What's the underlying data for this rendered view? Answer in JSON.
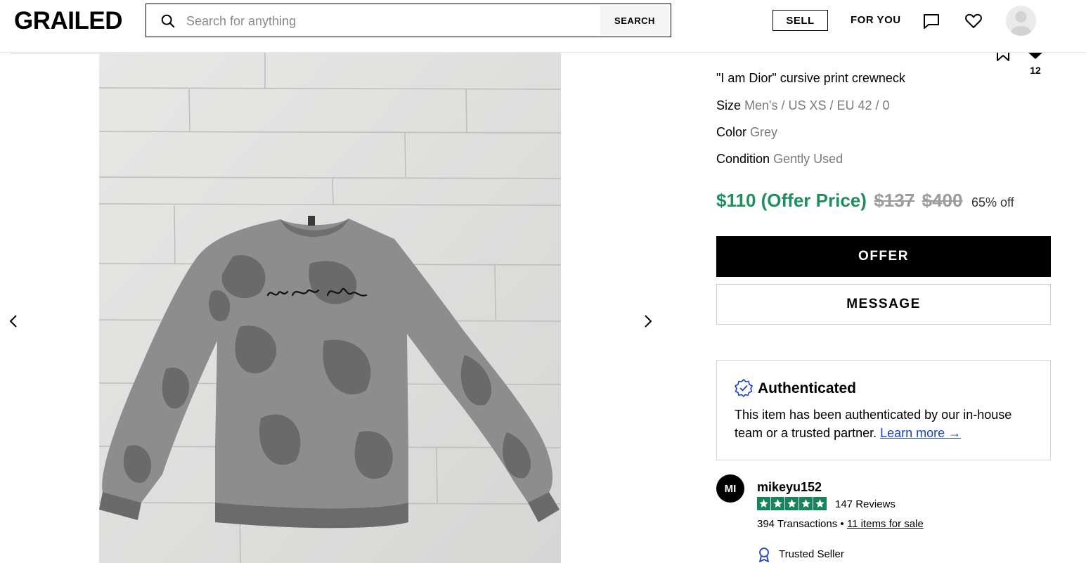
{
  "header": {
    "logo": "GRAILED",
    "search_placeholder": "Search for anything",
    "search_button": "SEARCH",
    "sell": "SELL",
    "for_you": "FOR YOU",
    "icons": [
      "search-icon",
      "message-icon",
      "heart-icon",
      "avatar"
    ]
  },
  "gallery": {
    "prev_icon": "chevron-left-icon",
    "next_icon": "chevron-right-icon",
    "photo_print": "i am dior"
  },
  "listing": {
    "like_count": "12",
    "title": "\"I am Dior\" cursive print crewneck",
    "size_label": "Size",
    "size_value": "Men's / US XS / EU 42 / 0",
    "color_label": "Color",
    "color_value": "Grey",
    "condition_label": "Condition",
    "condition_value": "Gently Used",
    "offer_price": "$110 (Offer Price)",
    "strike_price_1": "$137",
    "strike_price_2": "$400",
    "discount": "65% off",
    "offer_button": "OFFER",
    "message_button": "MESSAGE"
  },
  "auth": {
    "heading": "Authenticated",
    "text": "This item has been authenticated by our in-house team or a trusted partner.",
    "link": "Learn more →"
  },
  "seller": {
    "initials": "MI",
    "name": "mikeyu152",
    "rating": 5,
    "reviews": "147 Reviews",
    "transactions": "394 Transactions",
    "bullet": "•",
    "items_link": "11 items for sale",
    "trusted": "Trusted Seller"
  },
  "colors": {
    "accent_green": "#1f8f5f",
    "star_green": "#14865a",
    "link_blue": "#1a3fd6"
  }
}
